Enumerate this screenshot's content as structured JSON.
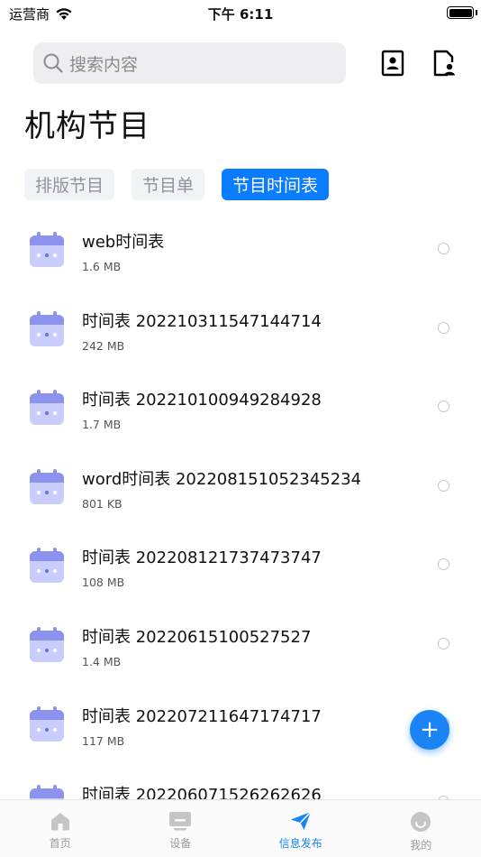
{
  "status_bar": {
    "carrier": "运营商",
    "time": "下午 6:11"
  },
  "search": {
    "placeholder": "搜索内容"
  },
  "page_title": "机构节目",
  "tabs": [
    {
      "label": "排版节目",
      "active": false
    },
    {
      "label": "节目单",
      "active": false
    },
    {
      "label": "节目时间表",
      "active": true
    }
  ],
  "files": [
    {
      "name": "web时间表",
      "size": "1.6 MB"
    },
    {
      "name": "时间表 20221031154714471 4",
      "size": "242 MB"
    },
    {
      "name": "时间表 202210100949284928",
      "size": "1.7 MB"
    },
    {
      "name": "word时间表 202208151052345234",
      "size": "801 KB"
    },
    {
      "name": "时间表 202208121737473747",
      "size": "108 MB"
    },
    {
      "name": "时间表 20220615100527527",
      "size": "1.4 MB"
    },
    {
      "name": "时间表 202207211647174717",
      "size": "117 MB"
    },
    {
      "name": "时间表 202206071526262626",
      "size": ""
    }
  ],
  "fab": {
    "label": "+"
  },
  "tabbar": [
    {
      "label": "首页",
      "icon": "home-icon",
      "active": false
    },
    {
      "label": "设备",
      "icon": "device-icon",
      "active": false
    },
    {
      "label": "信息发布",
      "icon": "send-icon",
      "active": true
    },
    {
      "label": "我的",
      "icon": "profile-icon",
      "active": false
    }
  ],
  "colors": {
    "accent": "#0a7cff",
    "calendar_icon": "#9aa3f3"
  }
}
